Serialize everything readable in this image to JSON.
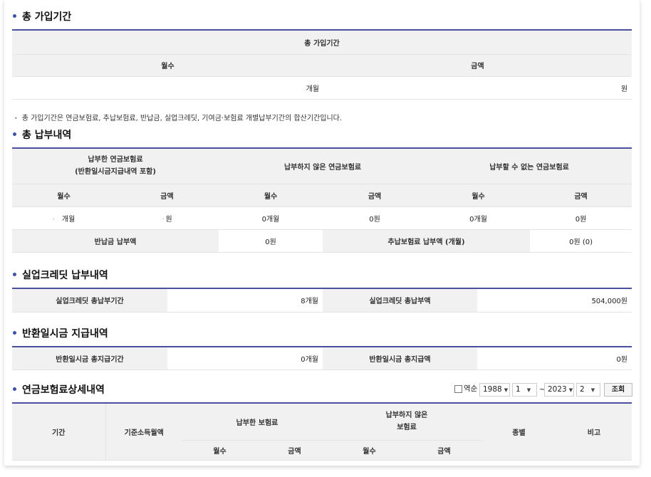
{
  "sections": {
    "total_period": {
      "heading": "총 가입기간",
      "table_title": "총 가입기간",
      "col_months": "월수",
      "col_amount": "금액",
      "months_unit": "개월",
      "amount_unit": "원"
    },
    "note": {
      "bullet": "•",
      "text": "총 가입기간은 연금보험료, 추납보험료, 반납금, 실업크레딧, 기여금·보험료 개별납부기간의 합산기간입니다."
    },
    "total_payment": {
      "heading": "총 납부내역",
      "group_paid_line1": "납부한 연금보험료",
      "group_paid_line2": "(반환일시금지급내역 포함)",
      "group_unpaid": "납부하지 않은 연금보험료",
      "group_cannot": "납부할 수 없는 연금보험료",
      "sub_months": "월수",
      "sub_amount": "금액",
      "row": {
        "paid_months_prefix": "·",
        "paid_months": "개월",
        "paid_amount_prefix": "·",
        "paid_amount": "원",
        "unpaid_months": "0개월",
        "unpaid_amount": "0원",
        "cannot_months": "0개월",
        "cannot_amount": "0원"
      },
      "refund_label": "반납금 납부액",
      "refund_value": "0원",
      "extra_label": "추납보험료 납부액 (개월)",
      "extra_value": "0원 (0)"
    },
    "unemployment": {
      "heading": "실업크레딧 납부내역",
      "period_label": "실업크레딧 총납부기간",
      "period_value": "8개월",
      "amount_label": "실업크레딧 총납부액",
      "amount_value": "504,000원"
    },
    "lump_sum": {
      "heading": "반환일시금 지급내역",
      "period_label": "반환일시금 총지급기간",
      "period_value": "0개월",
      "amount_label": "반환일시금 총지급액",
      "amount_value": "0원"
    },
    "detail": {
      "heading": "연금보험료상세내역",
      "reverse_label": "역순",
      "from_year": "1988",
      "from_month": "1",
      "tilde": "~",
      "to_year": "2023",
      "to_month": "2",
      "search_button": "조회",
      "col_period": "기간",
      "col_base_income": "기준소득월액",
      "col_paid": "납부한 보험료",
      "col_unpaid_line1": "납부하지 않은",
      "col_unpaid_line2": "보험료",
      "col_type": "종별",
      "col_remark": "비고",
      "sub_months": "월수",
      "sub_amount": "금액"
    }
  },
  "icons": {
    "select_arrow": "chevron-down-icon",
    "section_bullet": "dot-icon"
  },
  "colors": {
    "accent_line": "#4a4f9e",
    "header_bg": "#f1f1f1",
    "bullet": "#3a54a8"
  }
}
